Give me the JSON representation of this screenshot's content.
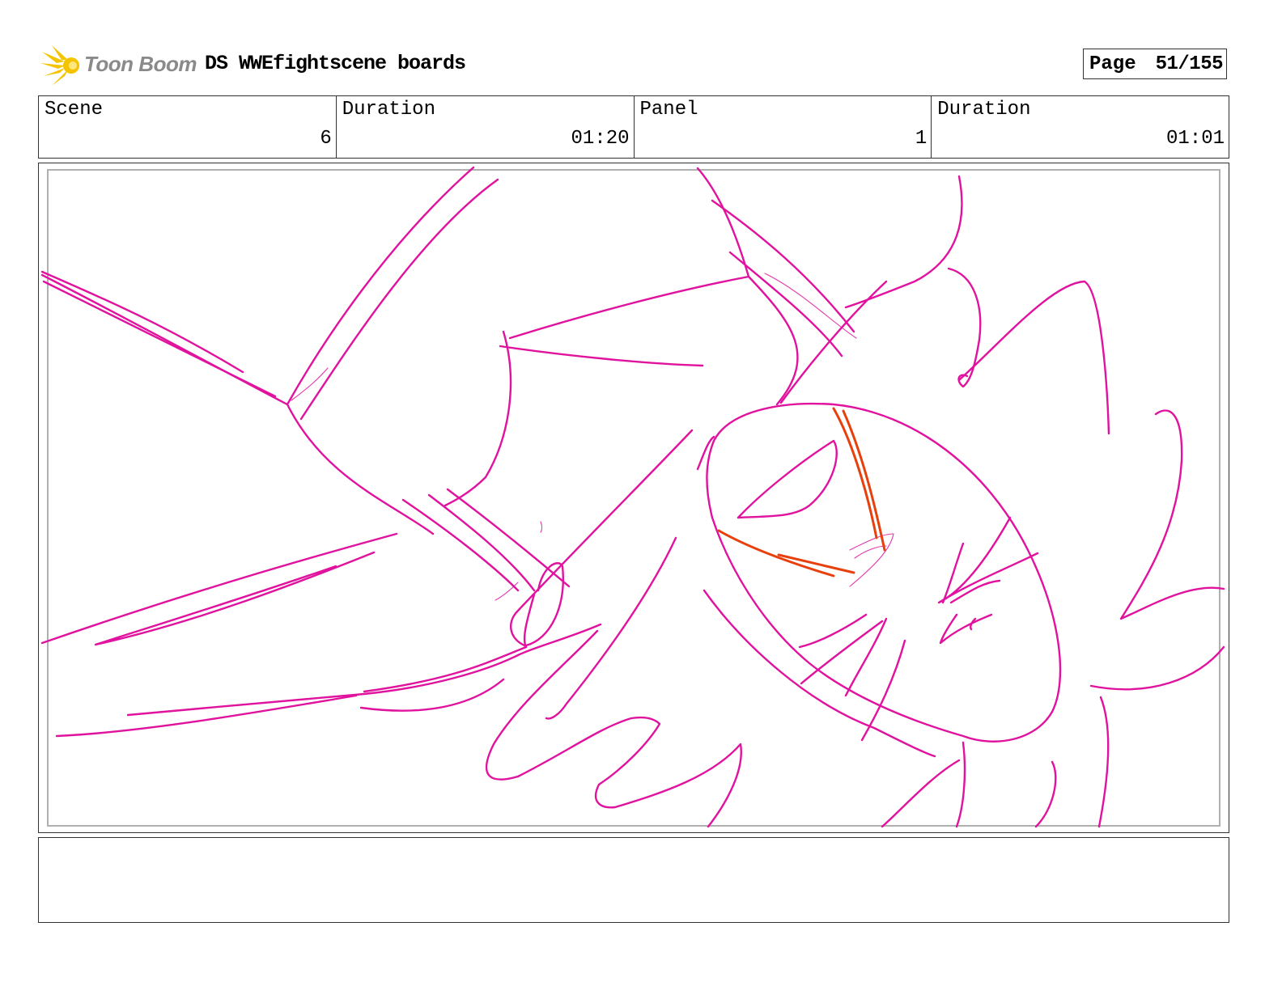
{
  "header": {
    "logo_text": "Toon Boom",
    "title": "DS WWEfightscene boards",
    "page_label": "Page",
    "page_value": "51/155"
  },
  "info": {
    "scene_label": "Scene",
    "scene_value": "6",
    "scene_duration_label": "Duration",
    "scene_duration_value": "01:20",
    "panel_label": "Panel",
    "panel_value": "1",
    "panel_duration_label": "Duration",
    "panel_duration_value": "01:01"
  },
  "notes": {
    "text": ""
  },
  "colors": {
    "sketch_primary": "#e0129e",
    "sketch_accent": "#e8400c",
    "logo_star": "#f5c400"
  }
}
